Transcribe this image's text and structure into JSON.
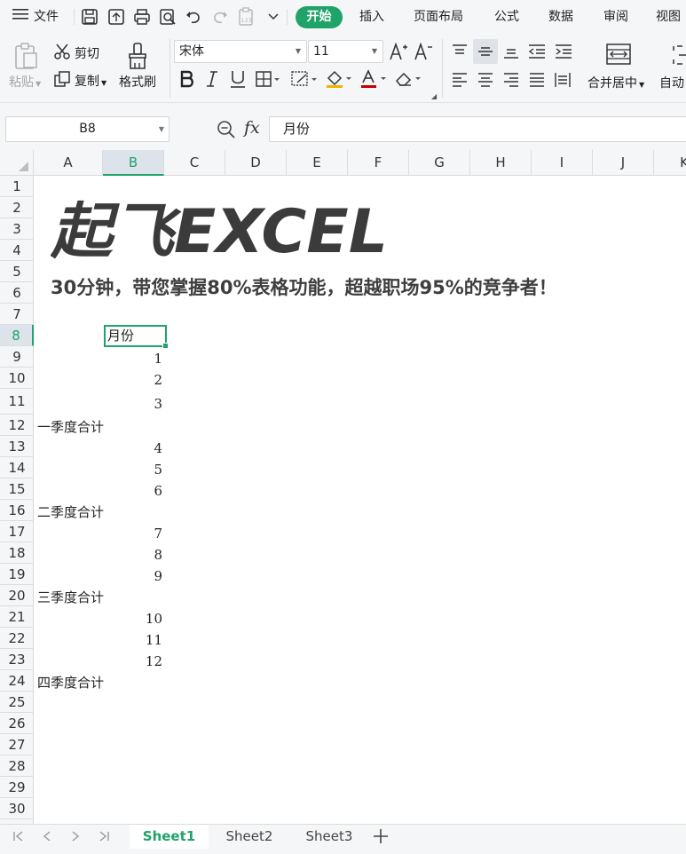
{
  "menu": {
    "file": "文件",
    "tabs": [
      "开始",
      "插入",
      "页面布局",
      "公式",
      "数据",
      "审阅",
      "视图"
    ]
  },
  "ribbon": {
    "paste": "粘贴",
    "cut": "剪切",
    "copy": "复制",
    "format_painter": "格式刷",
    "font_name": "宋体",
    "font_size": "11",
    "merge_center": "合并居中",
    "auto_wrap": "自动"
  },
  "formula_bar": {
    "cell_ref": "B8",
    "fx_label": "fx",
    "value": "月份"
  },
  "columns": [
    "A",
    "B",
    "C",
    "D",
    "E",
    "F",
    "G",
    "H",
    "I",
    "J",
    "K"
  ],
  "selected_column": "B",
  "rows": [
    "1",
    "2",
    "3",
    "4",
    "5",
    "6",
    "7",
    "8",
    "9",
    "10",
    "11",
    "12",
    "13",
    "14",
    "15",
    "16",
    "17",
    "18",
    "19",
    "20",
    "21",
    "22",
    "23",
    "24",
    "25",
    "26",
    "27",
    "28",
    "29",
    "30"
  ],
  "selected_row": "8",
  "sheet": {
    "logo_text": "起飞EXCEL",
    "slogan": "30分钟，带您掌握80%表格功能，超越职场95%的竞争者！",
    "header_cell": "月份",
    "cells": [
      {
        "text": "1",
        "kind": "num"
      },
      {
        "text": "2",
        "kind": "num"
      },
      {
        "text": "3",
        "kind": "num"
      },
      {
        "text": "一季度合计",
        "kind": "label"
      },
      {
        "text": "4",
        "kind": "num"
      },
      {
        "text": "5",
        "kind": "num"
      },
      {
        "text": "6",
        "kind": "num"
      },
      {
        "text": "二季度合计",
        "kind": "label"
      },
      {
        "text": "7",
        "kind": "num"
      },
      {
        "text": "8",
        "kind": "num"
      },
      {
        "text": "9",
        "kind": "num"
      },
      {
        "text": "三季度合计",
        "kind": "label"
      },
      {
        "text": "10",
        "kind": "num"
      },
      {
        "text": "11",
        "kind": "num"
      },
      {
        "text": "12",
        "kind": "num"
      },
      {
        "text": "四季度合计",
        "kind": "label"
      }
    ]
  },
  "sheet_tabs": [
    "Sheet1",
    "Sheet2",
    "Sheet3"
  ],
  "colors": {
    "accent": "#1fa368",
    "chrome": "#f5f6f7"
  }
}
